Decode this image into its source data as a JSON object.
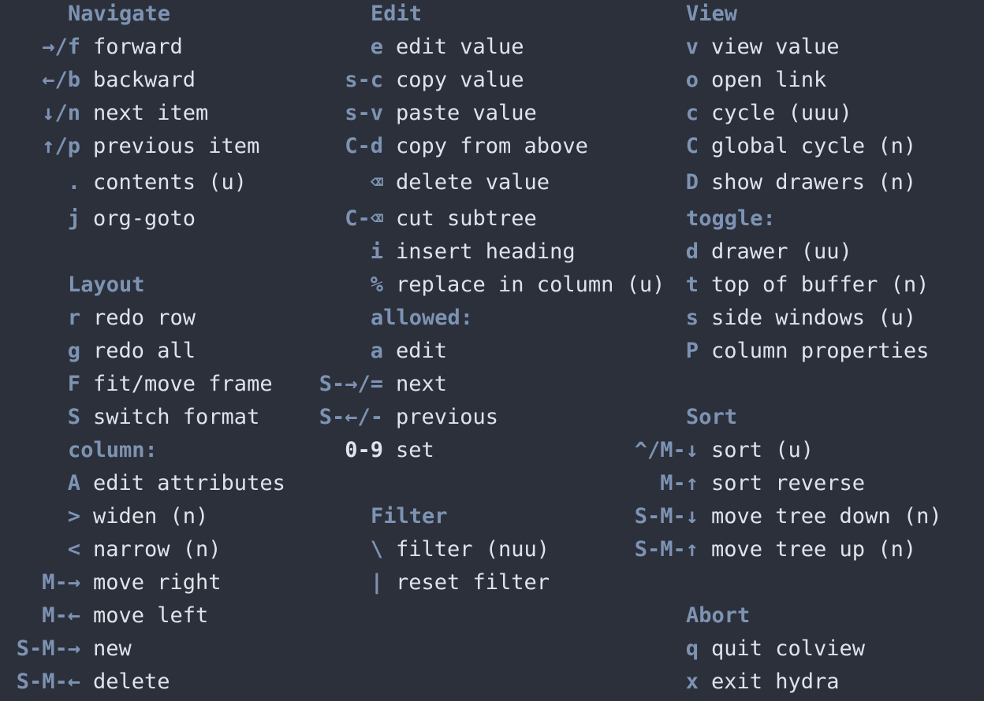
{
  "headings": {
    "navigate": "Navigate",
    "edit": "Edit",
    "view": "View",
    "layout": "Layout",
    "allowed": "allowed:",
    "toggle": "toggle:",
    "column": "column:",
    "filter": "Filter",
    "sort": "Sort",
    "abort": "Abort"
  },
  "navigate": [
    {
      "key": "→/f",
      "desc": "forward"
    },
    {
      "key": "←/b",
      "desc": "backward"
    },
    {
      "key": "↓/n",
      "desc": "next item"
    },
    {
      "key": "↑/p",
      "desc": "previous item"
    },
    {
      "key": ".",
      "desc": "contents (u)"
    },
    {
      "key": "j",
      "desc": "org-goto"
    }
  ],
  "layout": [
    {
      "key": "r",
      "desc": "redo row"
    },
    {
      "key": "g",
      "desc": "redo all"
    },
    {
      "key": "F",
      "desc": "fit/move frame"
    },
    {
      "key": "S",
      "desc": "switch format"
    }
  ],
  "column": [
    {
      "key": "A",
      "desc": "edit attributes"
    },
    {
      "key": ">",
      "desc": "widen (n)"
    },
    {
      "key": "<",
      "desc": "narrow (n)"
    },
    {
      "key": "M-→",
      "desc": "move right"
    },
    {
      "key": "M-←",
      "desc": "move left"
    },
    {
      "key": "S-M-→",
      "desc": "new"
    },
    {
      "key": "S-M-←",
      "desc": "delete"
    }
  ],
  "edit": [
    {
      "key": "e",
      "desc": "edit value"
    },
    {
      "key": "s-c",
      "desc": "copy value"
    },
    {
      "key": "s-v",
      "desc": "paste value"
    },
    {
      "key": "C-d",
      "desc": "copy from above"
    },
    {
      "key": "⌫",
      "desc": "delete value"
    },
    {
      "key": "C-⌫",
      "desc": "cut subtree"
    },
    {
      "key": "i",
      "desc": "insert heading"
    },
    {
      "key": "%",
      "desc": "replace in column (u)"
    }
  ],
  "allowed": [
    {
      "key": "a",
      "desc": "edit"
    },
    {
      "key": "S-→/=",
      "desc": "next"
    },
    {
      "key": "S-←/-",
      "desc": "previous"
    },
    {
      "key": "0-9",
      "desc": "set"
    }
  ],
  "filter": [
    {
      "key": "\\",
      "desc": "filter (nuu)"
    },
    {
      "key": "|",
      "desc": "reset filter"
    }
  ],
  "view": [
    {
      "key": "v",
      "desc": "view value"
    },
    {
      "key": "o",
      "desc": "open link"
    },
    {
      "key": "c",
      "desc": "cycle (uuu)"
    },
    {
      "key": "C",
      "desc": "global cycle (n)"
    },
    {
      "key": "D",
      "desc": "show drawers (n)"
    }
  ],
  "toggle": [
    {
      "key": "d",
      "desc": "drawer (uu)"
    },
    {
      "key": "t",
      "desc": "top of buffer (n)"
    },
    {
      "key": "s",
      "desc": "side windows (u)"
    },
    {
      "key": "P",
      "desc": "column properties"
    }
  ],
  "sort": [
    {
      "key": "^/M-↓",
      "desc": "sort (u)"
    },
    {
      "key": "M-↑",
      "desc": "sort reverse"
    },
    {
      "key": "S-M-↓",
      "desc": "move tree down (n)"
    },
    {
      "key": "S-M-↑",
      "desc": "move tree up (n)"
    }
  ],
  "abort": [
    {
      "key": "q",
      "desc": "quit colview"
    },
    {
      "key": "x",
      "desc": "exit hydra"
    }
  ]
}
